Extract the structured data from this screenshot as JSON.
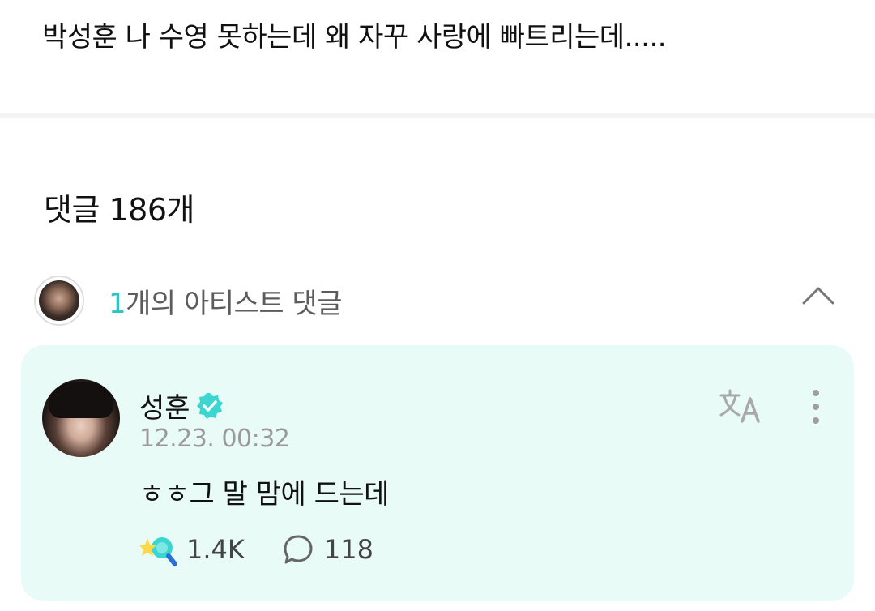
{
  "post": {
    "text": "박성훈 나 수영 못하는데 왜 자꾸 사랑에 빠트리는데....."
  },
  "comments": {
    "count_label": "댓글 186개"
  },
  "artist_comments": {
    "count": "1",
    "label_suffix": "개의 아티스트 댓글"
  },
  "comment": {
    "author": "성훈",
    "timestamp": "12.23. 00:32",
    "body": "ㅎㅎ그 말 맘에 드는데",
    "likes": "1.4K",
    "replies": "118"
  },
  "colors": {
    "accent": "#2ec4c4",
    "card_background": "#e8fbf6",
    "verified": "#3cd6d0"
  },
  "icons": [
    "chevron-up-icon",
    "verified-badge-icon",
    "translate-icon",
    "more-vertical-icon",
    "cheer-icon",
    "comment-bubble-icon"
  ]
}
